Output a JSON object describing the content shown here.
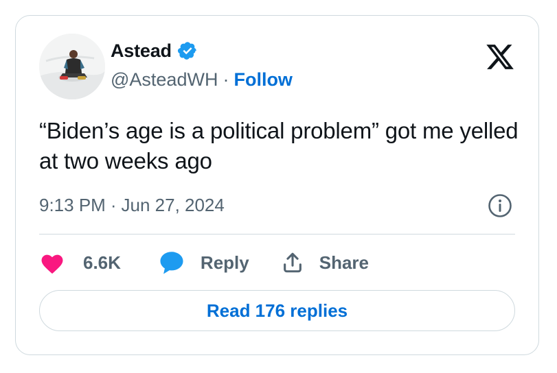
{
  "author": {
    "name": "Astead",
    "handle": "@AsteadWH",
    "separator": "·",
    "follow_label": "Follow",
    "verified": true,
    "verified_color": "#1d9bf0"
  },
  "tweet": {
    "text": "“Biden’s age is a political problem” got me yelled at two weeks ago",
    "time": "9:13 PM",
    "separator": "·",
    "date": "Jun 27, 2024"
  },
  "actions": {
    "like_count": "6.6K",
    "like_icon": "heart-icon",
    "like_color": "#f91880",
    "reply_label": "Reply",
    "reply_icon": "speech-bubble-icon",
    "reply_color": "#1d9bf0",
    "share_label": "Share",
    "share_icon": "share-upload-icon"
  },
  "footer": {
    "read_replies_label": "Read 176 replies"
  },
  "colors": {
    "link_blue": "#006fd6",
    "muted_text": "#536471",
    "border": "#cfd9de",
    "text": "#0f1419"
  }
}
